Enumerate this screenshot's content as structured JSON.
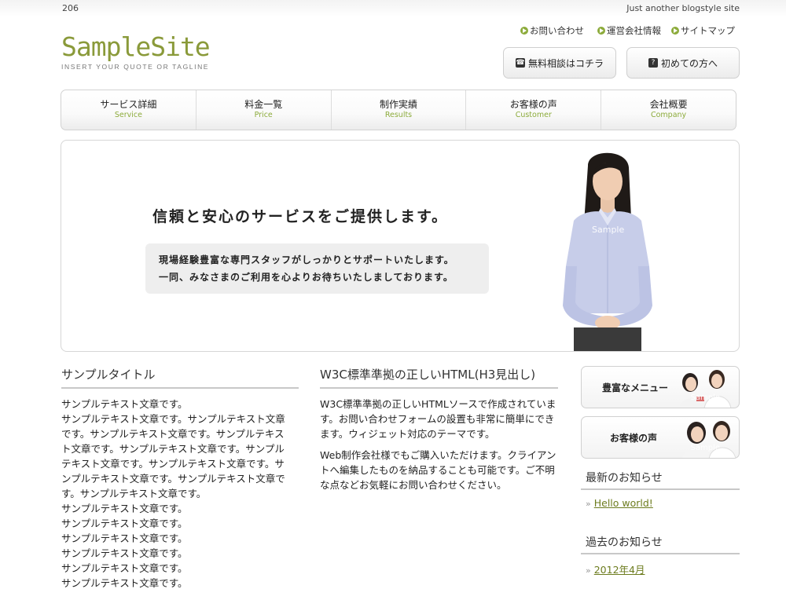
{
  "header": {
    "post_count": "206",
    "site_description": "Just another blogstyle site",
    "site_title": "SampleSite",
    "tagline": "INSERT YOUR QUOTE OR TAGLINE"
  },
  "top_links": [
    "お問い合わせ",
    "運営会社情報",
    "サイトマップ"
  ],
  "cta": {
    "consult": "無料相談はコチラ",
    "first_time": "初めての方へ",
    "phone_icon": "phone-icon",
    "question_icon": "question-icon"
  },
  "nav": [
    {
      "jp": "サービス詳細",
      "en": "Service"
    },
    {
      "jp": "料金一覧",
      "en": "Price"
    },
    {
      "jp": "制作実績",
      "en": "Results"
    },
    {
      "jp": "お客様の声",
      "en": "Customer"
    },
    {
      "jp": "会社概要",
      "en": "Company"
    }
  ],
  "hero": {
    "headline": "信頼と安心のサービスをご提供します。",
    "sub1": "現場経験豊富な専門スタッフがしっかりとサポートいたします。",
    "sub2": "一同、みなさまのご利用を心よりお待ちいたしましております。",
    "watermark": "Sample"
  },
  "col1": {
    "title": "サンプルタイトル",
    "body": [
      "サンプルテキスト文章です。",
      "サンプルテキスト文章です。サンプルテキスト文章",
      "です。サンプルテキスト文章です。サンプルテキス",
      "ト文章です。サンプルテキスト文章です。サンプル",
      "テキスト文章です。サンプルテキスト文章です。サ",
      "ンプルテキスト文章です。サンプルテキスト文章で",
      "す。サンプルテキスト文章です。",
      "サンプルテキスト文章です。",
      "サンプルテキスト文章です。",
      "サンプルテキスト文章です。",
      "サンプルテキスト文章です。",
      "サンプルテキスト文章です。",
      "サンプルテキスト文章です。"
    ]
  },
  "col2": {
    "title": "W3C標準準拠の正しいHTML(H3見出し)",
    "para1": "W3C標準準拠の正しいHTMLソースで作成されています。お問い合わせフォームの設置も非常に簡単にできます。ウィジェット対応のテーマです。",
    "para2": "Web制作会社様でもご購入いただけます。クライアントへ編集したものを納品することも可能です。ご不明な点などお気軽にお問い合わせください。"
  },
  "sidebar": {
    "banner1": "豊富なメニュー",
    "banner2": "お客様の声",
    "watermark": "Sample",
    "news_title": "最新のお知らせ",
    "news_link": "Hello world!",
    "archive_title": "過去のお知らせ",
    "archive_link": "2012年4月"
  },
  "colors": {
    "accent": "#8cab3b",
    "link": "#6d7c1f"
  }
}
